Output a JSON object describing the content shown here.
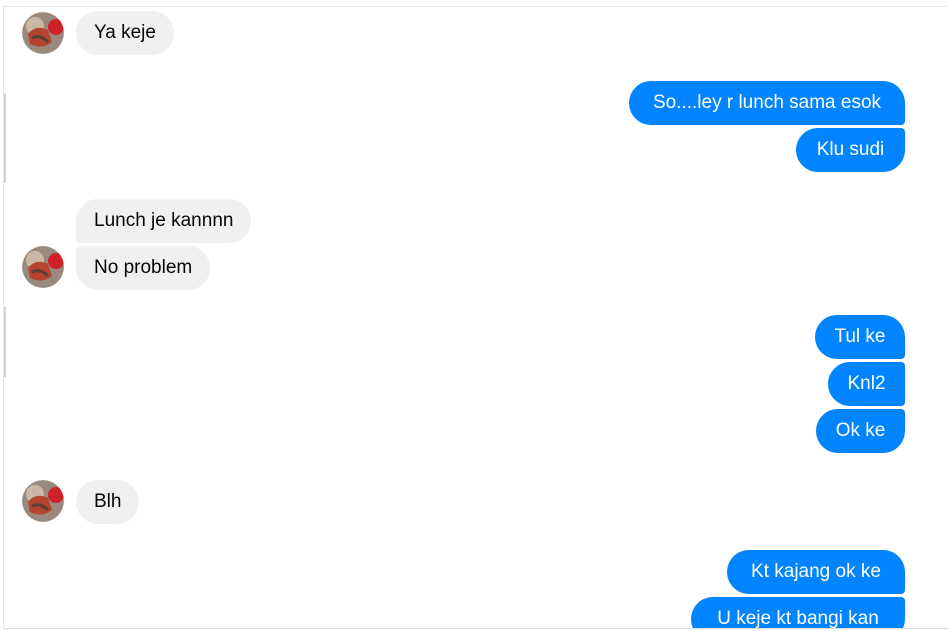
{
  "conversation": {
    "messages": [
      {
        "side": "in",
        "text": "Ya keje"
      },
      {
        "side": "out",
        "text": "So....ley r lunch sama esok"
      },
      {
        "side": "out",
        "text": "Klu sudi"
      },
      {
        "side": "in",
        "text": "Lunch je kannnn"
      },
      {
        "side": "in",
        "text": "No problem"
      },
      {
        "side": "out",
        "text": "Tul ke"
      },
      {
        "side": "out",
        "text": "Knl2"
      },
      {
        "side": "out",
        "text": "Ok ke"
      },
      {
        "side": "in",
        "text": "Blh"
      },
      {
        "side": "out",
        "text": "Kt kajang ok ke"
      },
      {
        "side": "out",
        "text": "U keje kt bangi kan"
      }
    ]
  },
  "colors": {
    "incoming_bubble": "#f0f0f0",
    "outgoing_bubble": "#0084ff",
    "incoming_text": "#050505",
    "outgoing_text": "#ffffff"
  },
  "icons": {
    "avatar": "contact-avatar-photo"
  }
}
